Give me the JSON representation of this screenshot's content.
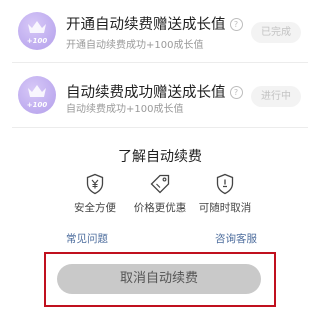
{
  "tasks": [
    {
      "title": "开通自动续费赠送成长值",
      "description": "开通自动续费成功+100成长值",
      "badge": "+100",
      "status": "已完成"
    },
    {
      "title": "自动续费成功赠送成长值",
      "description": "自动续费成功+100成长值",
      "badge": "+100",
      "status": "进行中"
    }
  ],
  "help_icon_glyph": "?",
  "auto_renew_info": {
    "title": "了解自动续费",
    "benefits": [
      {
        "label": "安全方便",
        "icon": "shield-yen-icon"
      },
      {
        "label": "价格更优惠",
        "icon": "price-tag-icon"
      },
      {
        "label": "可随时取消",
        "icon": "cancel-anytime-icon"
      }
    ],
    "faq_link": "常见问题",
    "support_link": "咨询客服"
  },
  "cancel_button_label": "取消自动续费",
  "colors": {
    "badge": "#c1aff0",
    "link": "#4e6e9e",
    "highlight_frame": "#c0101e",
    "cancel_button": "#c9c9c9"
  }
}
